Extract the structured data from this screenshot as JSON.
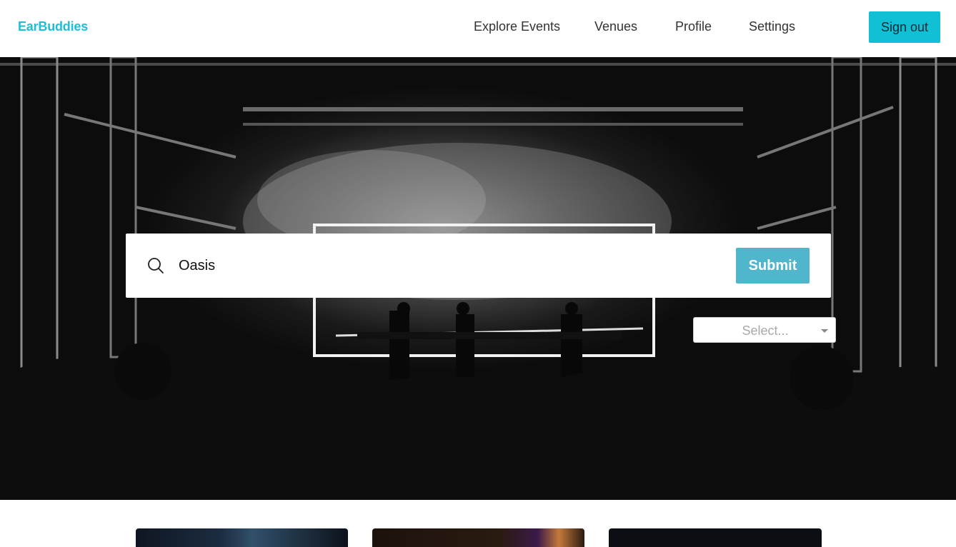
{
  "nav": {
    "brand": "EarBuddies",
    "links": [
      "Explore Events",
      "Venues",
      "Profile",
      "Settings"
    ],
    "signout_label": "Sign out"
  },
  "search": {
    "value": "Oasis",
    "submit_label": "Submit"
  },
  "filter": {
    "selected": "Select..."
  },
  "colors": {
    "brand": "#1cbfd8",
    "signout_bg": "#12c0d6",
    "submit_bg": "#4fb6cc"
  },
  "icons": [
    "search-icon",
    "caret-down-icon"
  ]
}
